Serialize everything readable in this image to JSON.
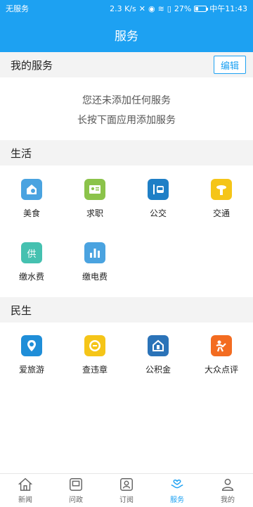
{
  "status_bar": {
    "carrier": "无服务",
    "network_speed": "2.3 K/s",
    "battery_pct": "27%",
    "battery_level": 0.27,
    "time": "中午11:43"
  },
  "header": {
    "title": "服务"
  },
  "my_services": {
    "title": "我的服务",
    "edit_label": "编辑",
    "empty_line1": "您还未添加任何服务",
    "empty_line2": "长按下面应用添加服务"
  },
  "life": {
    "title": "生活",
    "items": [
      {
        "label": "美食",
        "icon": "food-icon",
        "color": "#4aa3e0"
      },
      {
        "label": "求职",
        "icon": "job-icon",
        "color": "#8bc34a"
      },
      {
        "label": "公交",
        "icon": "bus-icon",
        "color": "#1f7fc6"
      },
      {
        "label": "交通",
        "icon": "traffic-icon",
        "color": "#f5c518"
      },
      {
        "label": "缴水费",
        "icon": "water-bill-icon",
        "color": "#45c1b0"
      },
      {
        "label": "缴电费",
        "icon": "electric-bill-icon",
        "color": "#4aa3e0"
      }
    ]
  },
  "livelihood": {
    "title": "民生",
    "items": [
      {
        "label": "爱旅游",
        "icon": "travel-icon",
        "color": "#1f8ed8"
      },
      {
        "label": "查违章",
        "icon": "violation-icon",
        "color": "#f5c518"
      },
      {
        "label": "公积金",
        "icon": "housing-fund-icon",
        "color": "#2b73b8"
      },
      {
        "label": "大众点评",
        "icon": "dianping-icon",
        "color": "#f36c21"
      }
    ]
  },
  "tabs": [
    {
      "label": "新闻",
      "icon": "home-icon"
    },
    {
      "label": "问政",
      "icon": "inquiry-icon"
    },
    {
      "label": "订阅",
      "icon": "subscribe-icon"
    },
    {
      "label": "服务",
      "icon": "service-icon",
      "active": true
    },
    {
      "label": "我的",
      "icon": "profile-icon"
    }
  ],
  "colors": {
    "primary": "#1da1f2",
    "section_bg": "#f3f3f3"
  }
}
